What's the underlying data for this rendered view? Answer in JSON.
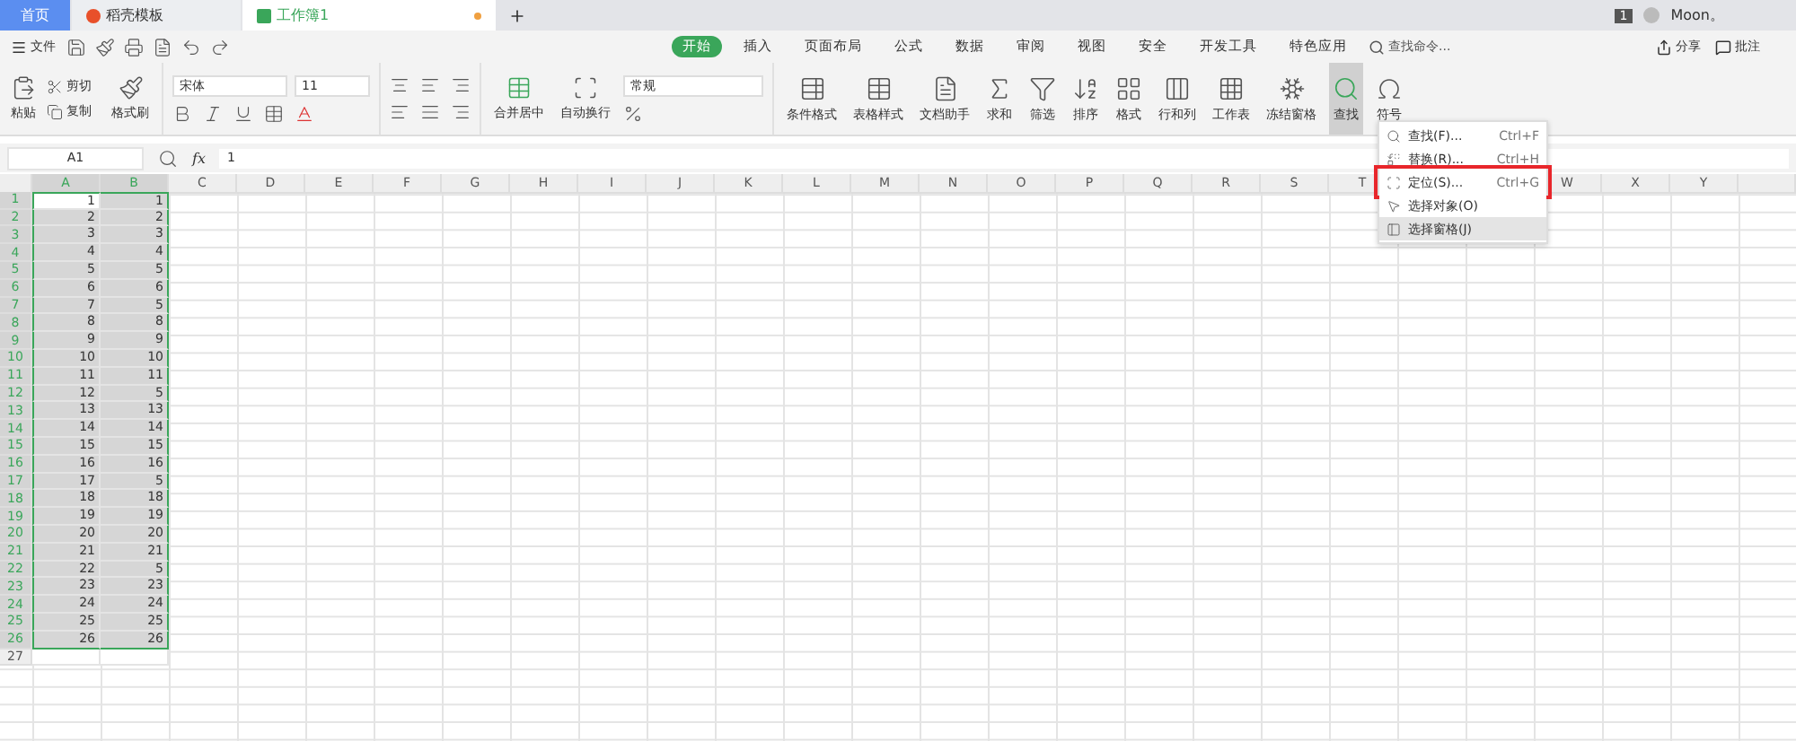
{
  "doc_tabs": [
    {
      "label": "首页",
      "kind": "home",
      "selected": false
    },
    {
      "label": "稻壳模板",
      "kind": "docer",
      "selected": false
    },
    {
      "label": "工作簿1",
      "kind": "sheet",
      "selected": true
    }
  ],
  "account": {
    "badge": "1",
    "name": "Moon。"
  },
  "file_menu": "文件",
  "menu_tabs": [
    {
      "label": "开始",
      "selected": true
    },
    {
      "label": "插入",
      "selected": false
    },
    {
      "label": "页面布局",
      "selected": false
    },
    {
      "label": "公式",
      "selected": false
    },
    {
      "label": "数据",
      "selected": false
    },
    {
      "label": "审阅",
      "selected": false
    },
    {
      "label": "视图",
      "selected": false
    },
    {
      "label": "安全",
      "selected": false
    },
    {
      "label": "开发工具",
      "selected": false
    },
    {
      "label": "特色应用",
      "selected": false
    }
  ],
  "command_search": {
    "placeholder": "查找命令..."
  },
  "share": "分享",
  "comment": "批注",
  "clipboard": {
    "paste": "粘贴",
    "cut": "剪切",
    "copy": "复制",
    "format_painter": "格式刷"
  },
  "font": {
    "name": "宋体",
    "size": "11"
  },
  "merge": "合并居中",
  "wrap": "自动换行",
  "number_format": "常规",
  "ribbon_tools": [
    {
      "label": "条件格式",
      "active": false
    },
    {
      "label": "表格样式",
      "active": false
    },
    {
      "label": "文档助手",
      "active": false
    },
    {
      "label": "求和",
      "active": false
    },
    {
      "label": "筛选",
      "active": false
    },
    {
      "label": "排序",
      "active": false
    },
    {
      "label": "格式",
      "active": false
    },
    {
      "label": "行和列",
      "active": false
    },
    {
      "label": "工作表",
      "active": false
    },
    {
      "label": "冻结窗格",
      "active": false
    },
    {
      "label": "查找",
      "active": true
    },
    {
      "label": "符号",
      "active": false
    }
  ],
  "name_box": "A1",
  "formula_label": "fx",
  "formula": "1",
  "columns": [
    "A",
    "B",
    "C",
    "D",
    "E",
    "F",
    "G",
    "H",
    "I",
    "J",
    "K",
    "L",
    "M",
    "N",
    "O",
    "P",
    "Q",
    "R",
    "S",
    "T",
    "W",
    "X",
    "Y"
  ],
  "rows": [
    {
      "n": "1",
      "a": "1",
      "b": "1",
      "selected": true
    },
    {
      "n": "2",
      "a": "2",
      "b": "2",
      "selected": true
    },
    {
      "n": "3",
      "a": "3",
      "b": "3",
      "selected": true
    },
    {
      "n": "4",
      "a": "4",
      "b": "4",
      "selected": true
    },
    {
      "n": "5",
      "a": "5",
      "b": "5",
      "selected": true
    },
    {
      "n": "6",
      "a": "6",
      "b": "6",
      "selected": true
    },
    {
      "n": "7",
      "a": "7",
      "b": "5",
      "selected": true
    },
    {
      "n": "8",
      "a": "8",
      "b": "8",
      "selected": true
    },
    {
      "n": "9",
      "a": "9",
      "b": "9",
      "selected": true
    },
    {
      "n": "10",
      "a": "10",
      "b": "10",
      "selected": true
    },
    {
      "n": "11",
      "a": "11",
      "b": "11",
      "selected": true
    },
    {
      "n": "12",
      "a": "12",
      "b": "5",
      "selected": true
    },
    {
      "n": "13",
      "a": "13",
      "b": "13",
      "selected": true
    },
    {
      "n": "14",
      "a": "14",
      "b": "14",
      "selected": true
    },
    {
      "n": "15",
      "a": "15",
      "b": "15",
      "selected": true
    },
    {
      "n": "16",
      "a": "16",
      "b": "16",
      "selected": true
    },
    {
      "n": "17",
      "a": "17",
      "b": "5",
      "selected": true
    },
    {
      "n": "18",
      "a": "18",
      "b": "18",
      "selected": true
    },
    {
      "n": "19",
      "a": "19",
      "b": "19",
      "selected": true
    },
    {
      "n": "20",
      "a": "20",
      "b": "20",
      "selected": true
    },
    {
      "n": "21",
      "a": "21",
      "b": "21",
      "selected": true
    },
    {
      "n": "22",
      "a": "22",
      "b": "5",
      "selected": true
    },
    {
      "n": "23",
      "a": "23",
      "b": "23",
      "selected": true
    },
    {
      "n": "24",
      "a": "24",
      "b": "24",
      "selected": true
    },
    {
      "n": "25",
      "a": "25",
      "b": "25",
      "selected": true
    },
    {
      "n": "26",
      "a": "26",
      "b": "26",
      "selected": true
    },
    {
      "n": "27",
      "selected": false
    }
  ],
  "find_menu": [
    {
      "label": "查找(F)...",
      "shortcut": "Ctrl+F",
      "highlighted": false,
      "boxed": false
    },
    {
      "label": "替换(R)...",
      "shortcut": "Ctrl+H",
      "highlighted": false,
      "boxed": false
    },
    {
      "label": "定位(S)...",
      "shortcut": "Ctrl+G",
      "highlighted": false,
      "boxed": true
    },
    {
      "label": "选择对象(O)",
      "highlighted": false,
      "boxed": false
    },
    {
      "label": "选择窗格(J)",
      "highlighted": true,
      "boxed": false
    }
  ]
}
